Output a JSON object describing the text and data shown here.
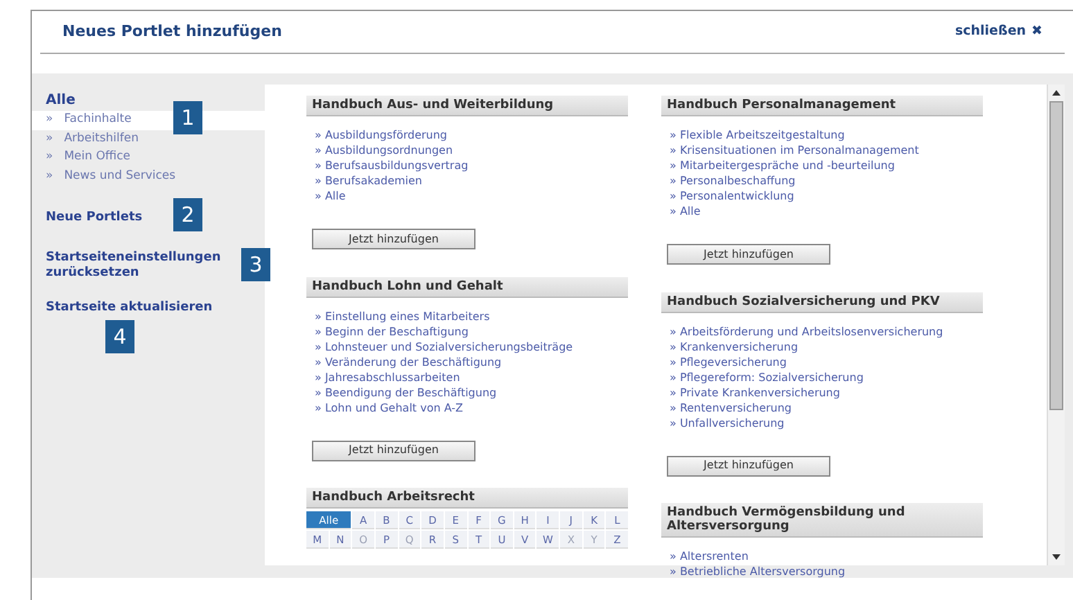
{
  "window": {
    "title": "Neues Portlet hinzufügen",
    "close": {
      "label": "schließen",
      "icon": "✖"
    }
  },
  "sidebar": {
    "heading": "Alle",
    "items": [
      {
        "label": "Fachinhalte",
        "marker": "»",
        "selected": true
      },
      {
        "label": "Arbeitshilfen",
        "marker": "»",
        "selected": false
      },
      {
        "label": "Mein Office",
        "marker": "»",
        "selected": false
      },
      {
        "label": "News und Services",
        "marker": "»",
        "selected": false
      }
    ],
    "links": [
      "Neue Portlets",
      "Startseiteneinstellungen zurücksetzen",
      "Startseite aktualisieren"
    ]
  },
  "callouts": [
    "1",
    "2",
    "3",
    "4"
  ],
  "columns": [
    [
      {
        "kind": "links",
        "title": "Handbuch Aus- und Weiterbildung",
        "links": [
          "» Ausbildungsförderung",
          "» Ausbildungsordnungen",
          "» Berufsausbildungsvertrag",
          "» Berufsakademien",
          "» Alle"
        ],
        "button": "Jetzt hinzufügen"
      },
      {
        "kind": "links",
        "title": "Handbuch Lohn und Gehalt",
        "links": [
          "» Einstellung eines Mitarbeiters",
          "» Beginn der Beschaftigung",
          "» Lohnsteuer und Sozialversicherungsbeiträge",
          "» Veränderung der Beschäftigung",
          "» Jahresabschlussarbeiten",
          "» Beendigung der Beschäftigung",
          "» Lohn und Gehalt von A-Z"
        ],
        "button": "Jetzt hinzufügen"
      },
      {
        "kind": "alphabet",
        "title": "Handbuch Arbeitsrecht",
        "letters": [
          {
            "label": "Alle",
            "selected": true,
            "disabled": false
          },
          {
            "label": "A",
            "selected": false,
            "disabled": false
          },
          {
            "label": "B",
            "selected": false,
            "disabled": false
          },
          {
            "label": "C",
            "selected": false,
            "disabled": false
          },
          {
            "label": "D",
            "selected": false,
            "disabled": false
          },
          {
            "label": "E",
            "selected": false,
            "disabled": false
          },
          {
            "label": "F",
            "selected": false,
            "disabled": false
          },
          {
            "label": "G",
            "selected": false,
            "disabled": false
          },
          {
            "label": "H",
            "selected": false,
            "disabled": false
          },
          {
            "label": "I",
            "selected": false,
            "disabled": false
          },
          {
            "label": "J",
            "selected": false,
            "disabled": false
          },
          {
            "label": "K",
            "selected": false,
            "disabled": false
          },
          {
            "label": "L",
            "selected": false,
            "disabled": false
          },
          {
            "label": "M",
            "selected": false,
            "disabled": false
          },
          {
            "label": "N",
            "selected": false,
            "disabled": false
          },
          {
            "label": "O",
            "selected": false,
            "disabled": true
          },
          {
            "label": "P",
            "selected": false,
            "disabled": false
          },
          {
            "label": "Q",
            "selected": false,
            "disabled": true
          },
          {
            "label": "R",
            "selected": false,
            "disabled": false
          },
          {
            "label": "S",
            "selected": false,
            "disabled": false
          },
          {
            "label": "T",
            "selected": false,
            "disabled": false
          },
          {
            "label": "U",
            "selected": false,
            "disabled": false
          },
          {
            "label": "V",
            "selected": false,
            "disabled": false
          },
          {
            "label": "W",
            "selected": false,
            "disabled": false
          },
          {
            "label": "X",
            "selected": false,
            "disabled": true
          },
          {
            "label": "Y",
            "selected": false,
            "disabled": true
          },
          {
            "label": "Z",
            "selected": false,
            "disabled": false
          }
        ]
      }
    ],
    [
      {
        "kind": "links",
        "title": "Handbuch Personalmanagement",
        "links": [
          "» Flexible Arbeitszeitgestaltung",
          "» Krisensituationen im Personalmanagement",
          "» Mitarbeitergespräche und -beurteilung",
          "» Personalbeschaffung",
          "» Personalentwicklung",
          "» Alle"
        ],
        "button": "Jetzt hinzufügen"
      },
      {
        "kind": "links",
        "title": "Handbuch Sozialversicherung und PKV",
        "links": [
          "» Arbeitsförderung und Arbeitslosenversicherung",
          "» Krankenversicherung",
          "» Pflegeversicherung",
          "» Pflegereform: Sozialversicherung",
          "» Private Krankenversicherung",
          "» Rentenversicherung",
          "» Unfallversicherung"
        ],
        "button": "Jetzt hinzufügen"
      },
      {
        "kind": "links",
        "title": "Handbuch Vermögensbildung und Altersversorgung",
        "links": [
          "» Altersrenten",
          "» Betriebliche Altersversorgung"
        ]
      }
    ]
  ]
}
